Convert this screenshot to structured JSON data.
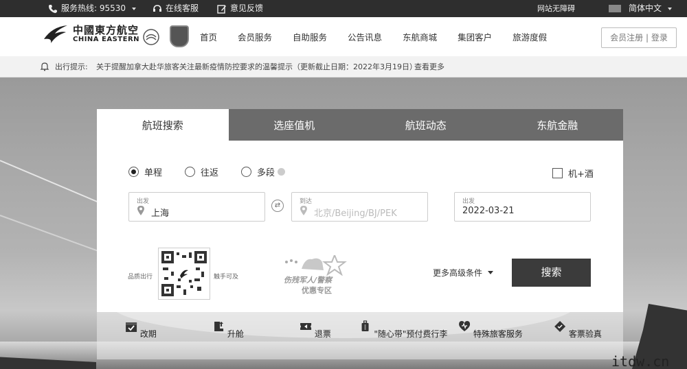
{
  "topbar": {
    "hotline": "服务热线: 95530",
    "online_service": "在线客服",
    "feedback": "意见反馈",
    "accessibility": "网站无障碍",
    "language": "简体中文"
  },
  "header": {
    "logo_cn": "中國東方航空",
    "logo_en": "CHINA EASTERN",
    "nav": [
      "首页",
      "会员服务",
      "自助服务",
      "公告讯息",
      "东航商城",
      "集团客户",
      "旅游度假"
    ],
    "login": "会员注册 | 登录"
  },
  "notice": {
    "label": "出行提示:",
    "message": "关于提醒加拿大赴华旅客关注最新疫情防控要求的温馨提示（更新截止日期：2022年3月19日）",
    "more": "查看更多"
  },
  "search": {
    "tabs": [
      "航班搜索",
      "选座值机",
      "航班动态",
      "东航金融"
    ],
    "active_tab": 0,
    "trip_types": [
      "单程",
      "往返",
      "多段"
    ],
    "selected_trip": "单程",
    "hotel_combo": "机+酒",
    "from": {
      "label": "出发",
      "value": "上海"
    },
    "to": {
      "label": "到达",
      "placeholder": "北京/Beijing/BJ/PEK"
    },
    "date": {
      "label": "出发",
      "value": "2022-03-21"
    },
    "qr_left": "品质出行",
    "qr_right": "触手可及",
    "promo_line1": "伤残军人/警察",
    "promo_line2": "优惠专区",
    "advanced": "更多高级条件",
    "submit": "搜索"
  },
  "services": [
    "改期",
    "升舱",
    "退票",
    "\"随心带\"预付费行李",
    "特殊旅客服务",
    "客票验真"
  ],
  "watermark": "itdw.cn"
}
